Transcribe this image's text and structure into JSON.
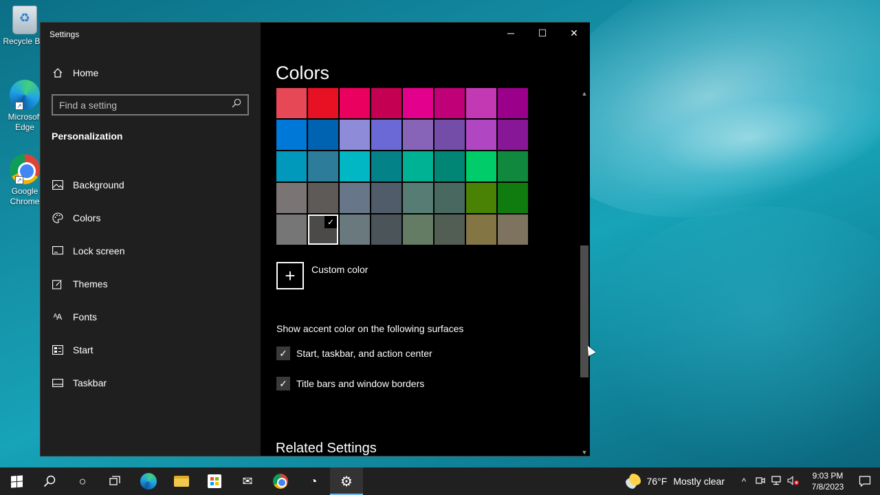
{
  "desktop": {
    "icons": [
      {
        "label": "Recycle Bin"
      },
      {
        "label": "Microsoft Edge"
      },
      {
        "label": "Google Chrome"
      }
    ]
  },
  "window": {
    "app_title": "Settings",
    "controls": {
      "minimize": "─",
      "maximize": "☐",
      "close": "✕"
    }
  },
  "sidebar": {
    "home_label": "Home",
    "search_placeholder": "Find a setting",
    "section_title": "Personalization",
    "items": [
      {
        "label": "Background",
        "icon": "image-icon"
      },
      {
        "label": "Colors",
        "icon": "palette-icon"
      },
      {
        "label": "Lock screen",
        "icon": "lock-screen-icon"
      },
      {
        "label": "Themes",
        "icon": "brush-icon"
      },
      {
        "label": "Fonts",
        "icon": "font-icon"
      },
      {
        "label": "Start",
        "icon": "start-icon"
      },
      {
        "label": "Taskbar",
        "icon": "taskbar-icon"
      }
    ]
  },
  "content": {
    "page_title": "Colors",
    "swatches": [
      "#e74856",
      "#e81123",
      "#ea005e",
      "#c30052",
      "#e3008c",
      "#bf0077",
      "#c239b3",
      "#9a0089",
      "#0078d7",
      "#0063b1",
      "#8e8cd8",
      "#6b69d6",
      "#8764b8",
      "#744da9",
      "#b146c2",
      "#881798",
      "#0099bc",
      "#2d7d9a",
      "#00b7c3",
      "#038387",
      "#00b294",
      "#018574",
      "#00cc6a",
      "#10893e",
      "#7a7574",
      "#5d5a58",
      "#68768a",
      "#515c6b",
      "#567c73",
      "#486860",
      "#498205",
      "#107c10",
      "#767676",
      "#4c4a48",
      "#69797e",
      "#4a5459",
      "#647c64",
      "#525e54",
      "#847545",
      "#7e735f"
    ],
    "selected_swatch_index": 33,
    "selected_check": "✓",
    "custom_color_icon": "+",
    "custom_color_label": "Custom color",
    "surfaces_label": "Show accent color on the following surfaces",
    "checks": [
      {
        "label": "Start, taskbar, and action center",
        "checked": true,
        "mark": "✓"
      },
      {
        "label": "Title bars and window borders",
        "checked": true,
        "mark": "✓"
      }
    ],
    "related_title": "Related Settings",
    "scroll_up": "▲",
    "scroll_down": "▼"
  },
  "taskbar": {
    "search_icon": "⚲",
    "cortana_icon": "○",
    "taskview_icon": "⧉",
    "mail_icon": "✉",
    "speed_icon": "◔",
    "settings_icon": "⚙",
    "weather_temp": "76°F",
    "weather_text": "Mostly clear",
    "tray_chevron": "^",
    "time": "9:03 PM",
    "date": "7/8/2023",
    "notification_icon": "🗨"
  }
}
